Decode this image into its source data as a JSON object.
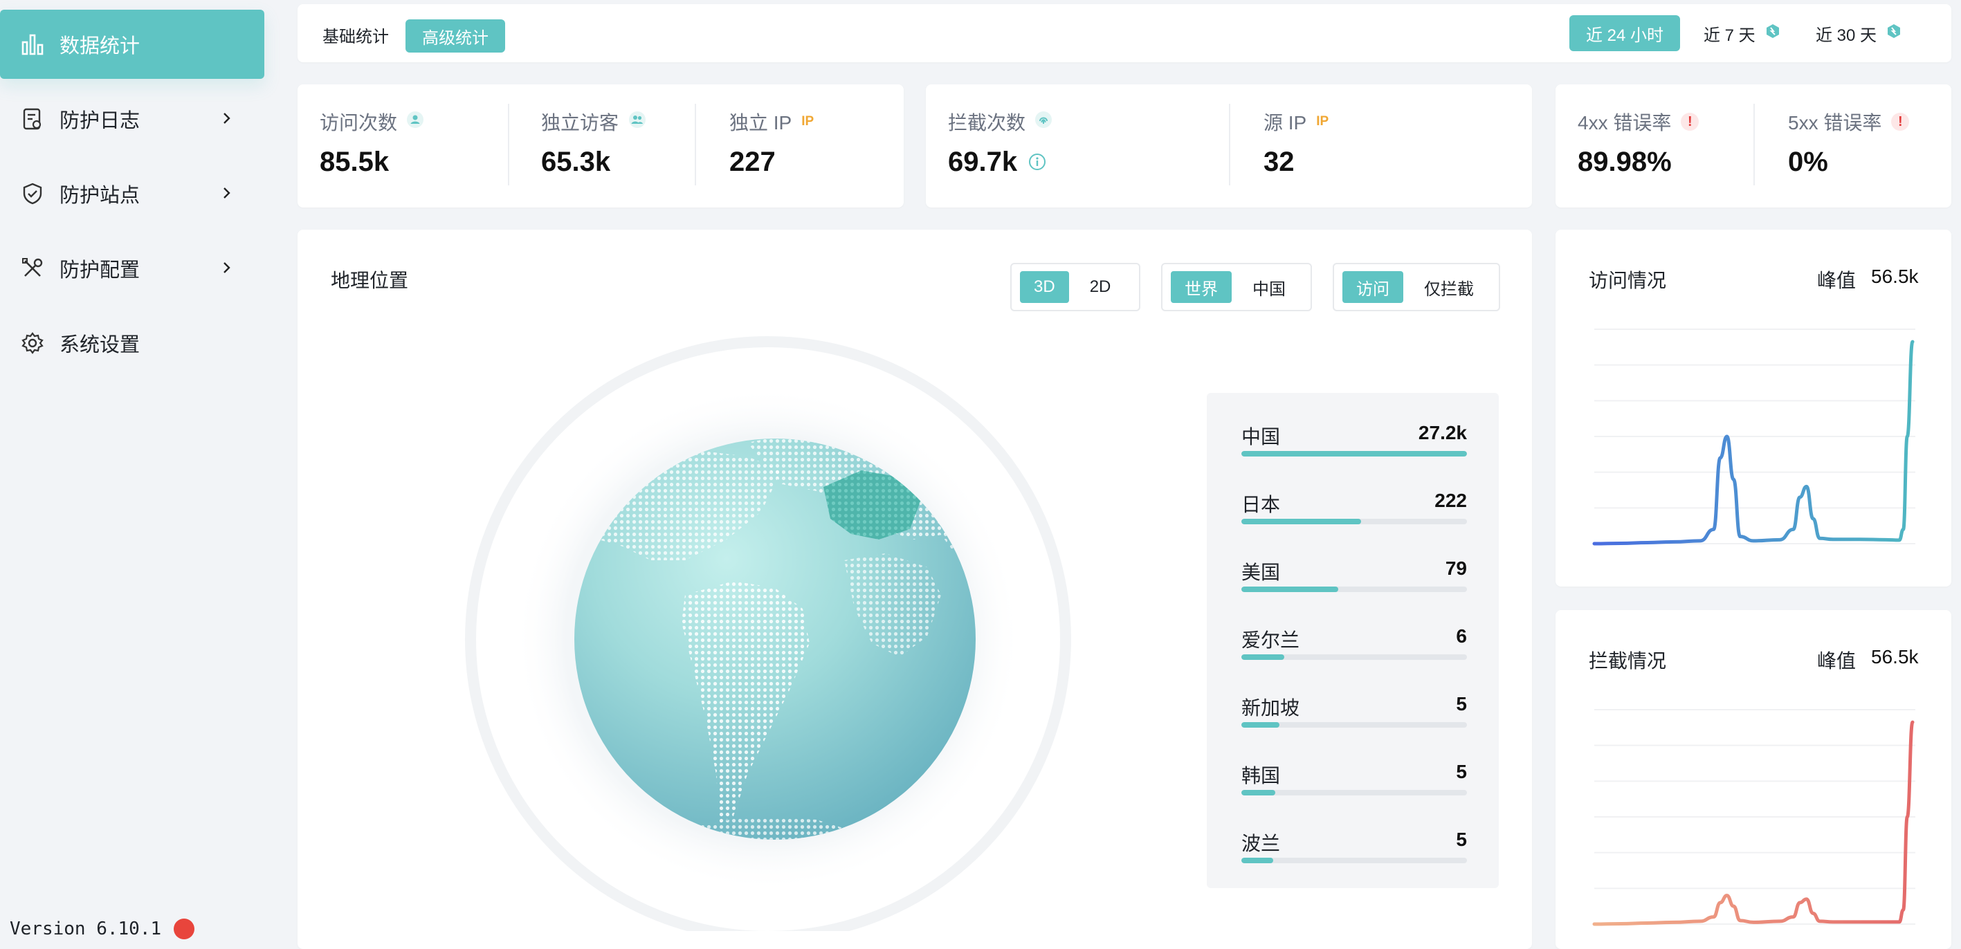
{
  "sidebar": {
    "items": [
      {
        "label": "数据统计",
        "icon": "bar-chart-icon",
        "active": true
      },
      {
        "label": "防护日志",
        "icon": "log-file-icon",
        "active": false
      },
      {
        "label": "防护站点",
        "icon": "shield-icon",
        "active": false
      },
      {
        "label": "防护配置",
        "icon": "tools-icon",
        "active": false
      },
      {
        "label": "系统设置",
        "icon": "gear-icon",
        "active": false
      }
    ],
    "version": "Version 6.10.1"
  },
  "topbar": {
    "tabs": [
      "基础统计",
      "高级统计"
    ],
    "active_tab": "高级统计",
    "ranges": [
      "近 24 小时",
      "近 7 天",
      "近 30 天"
    ],
    "active_range": "近 24 小时"
  },
  "stats": {
    "visits": {
      "label": "访问次数",
      "value": "85.5k"
    },
    "unique_visitors": {
      "label": "独立访客",
      "value": "65.3k"
    },
    "unique_ip": {
      "label": "独立 IP",
      "value": "227",
      "tag": "IP"
    },
    "blocked": {
      "label": "拦截次数",
      "value": "69.7k"
    },
    "source_ip": {
      "label": "源 IP",
      "value": "32",
      "tag": "IP"
    },
    "err4xx": {
      "label": "4xx 错误率",
      "value": "89.98%"
    },
    "err5xx": {
      "label": "5xx 错误率",
      "value": "0%"
    }
  },
  "geo": {
    "title": "地理位置",
    "view_modes": [
      "3D",
      "2D"
    ],
    "active_view": "3D",
    "regions": [
      "世界",
      "中国"
    ],
    "active_region": "世界",
    "filters": [
      "访问",
      "仅拦截"
    ],
    "active_filter": "访问",
    "countries": [
      {
        "name": "中国",
        "value": "27.2k",
        "pct": 100
      },
      {
        "name": "日本",
        "value": "222",
        "pct": 53
      },
      {
        "name": "美国",
        "value": "79",
        "pct": 43
      },
      {
        "name": "爱尔兰",
        "value": "6",
        "pct": 19
      },
      {
        "name": "新加坡",
        "value": "5",
        "pct": 17
      },
      {
        "name": "韩国",
        "value": "5",
        "pct": 15
      },
      {
        "name": "波兰",
        "value": "5",
        "pct": 14
      }
    ]
  },
  "visits_chart": {
    "title": "访问情况",
    "peak_label": "峰值",
    "peak_value": "56.5k"
  },
  "blocked_chart": {
    "title": "拦截情况",
    "peak_label": "峰值",
    "peak_value": "56.5k"
  },
  "colors": {
    "accent": "#5fc4c3",
    "visits_line": "#4a6de0",
    "blocked_line": "#e46a6a",
    "error": "#e23b3b",
    "ip_tag": "#f0a733"
  },
  "chart_data": [
    {
      "type": "line",
      "title": "访问情况",
      "x": [
        0,
        2,
        4,
        6,
        8,
        9,
        9.5,
        10,
        10.5,
        11,
        12,
        14,
        15,
        15.5,
        16,
        16.5,
        17,
        18,
        20,
        22,
        23,
        23.3,
        23.6,
        24
      ],
      "values": [
        0,
        0.1,
        0.3,
        0.5,
        0.8,
        4,
        24,
        30,
        18,
        2,
        0.8,
        1.1,
        4,
        13,
        16,
        7,
        1.5,
        1.2,
        1.2,
        1.1,
        1.0,
        4,
        30,
        56.5
      ],
      "ylim": [
        0,
        60
      ],
      "grid": true
    },
    {
      "type": "area",
      "title": "拦截情况",
      "x": [
        0,
        2,
        4,
        6,
        8,
        9,
        9.5,
        10,
        10.5,
        11,
        12,
        14,
        15,
        15.5,
        16,
        16.5,
        17,
        18,
        20,
        22,
        23,
        23.3,
        23.6,
        24
      ],
      "values": [
        0,
        0.1,
        0.3,
        0.5,
        0.8,
        2,
        6,
        8,
        5,
        1,
        0.5,
        0.8,
        2,
        6,
        7,
        3,
        0.8,
        0.6,
        0.6,
        0.6,
        0.6,
        4,
        30,
        56.5
      ],
      "ylim": [
        0,
        60
      ],
      "grid": true
    }
  ]
}
